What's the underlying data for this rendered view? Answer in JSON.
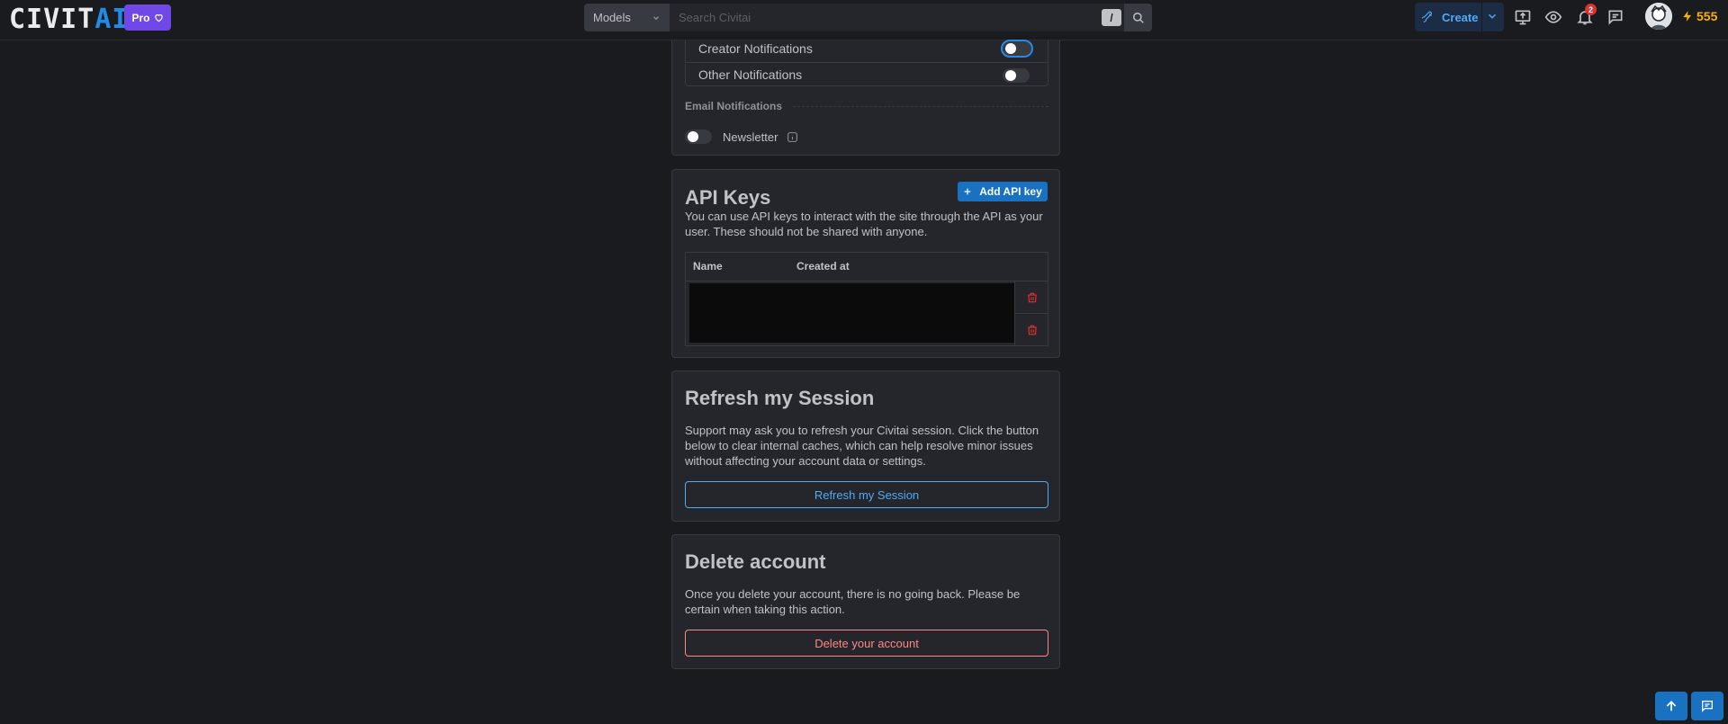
{
  "header": {
    "logo": {
      "main": "CIVIT",
      "accent": "AI"
    },
    "pro_label": "Pro",
    "search": {
      "scope": "Models",
      "placeholder": "Search Civitai",
      "shortcut": "/"
    },
    "create_label": "Create",
    "notification_count": "2",
    "buzz_amount": "555"
  },
  "notifications": {
    "rows": [
      {
        "label": "Creator Notifications",
        "enabled": false
      },
      {
        "label": "Other Notifications",
        "enabled": false
      }
    ],
    "email_section_label": "Email Notifications",
    "newsletter_label": "Newsletter"
  },
  "api_keys": {
    "title": "API Keys",
    "description": "You can use API keys to interact with the site through the API as your user. These should not be shared with anyone.",
    "add_label": "Add API key",
    "columns": [
      "Name",
      "Created at"
    ]
  },
  "refresh": {
    "title": "Refresh my Session",
    "description": "Support may ask you to refresh your Civitai session. Click the button below to clear internal caches, which can help resolve minor issues without affecting your account data or settings.",
    "button_label": "Refresh my Session"
  },
  "delete": {
    "title": "Delete account",
    "description": "Once you delete your account, there is no going back. Please be certain when taking this action.",
    "button_label": "Delete your account"
  },
  "colors": {
    "background": "#1a1b1e",
    "card": "#25262b",
    "primary": "#1971c2",
    "pro": "#7048e8",
    "danger": "#ff8787",
    "buzz": "#fab005"
  }
}
